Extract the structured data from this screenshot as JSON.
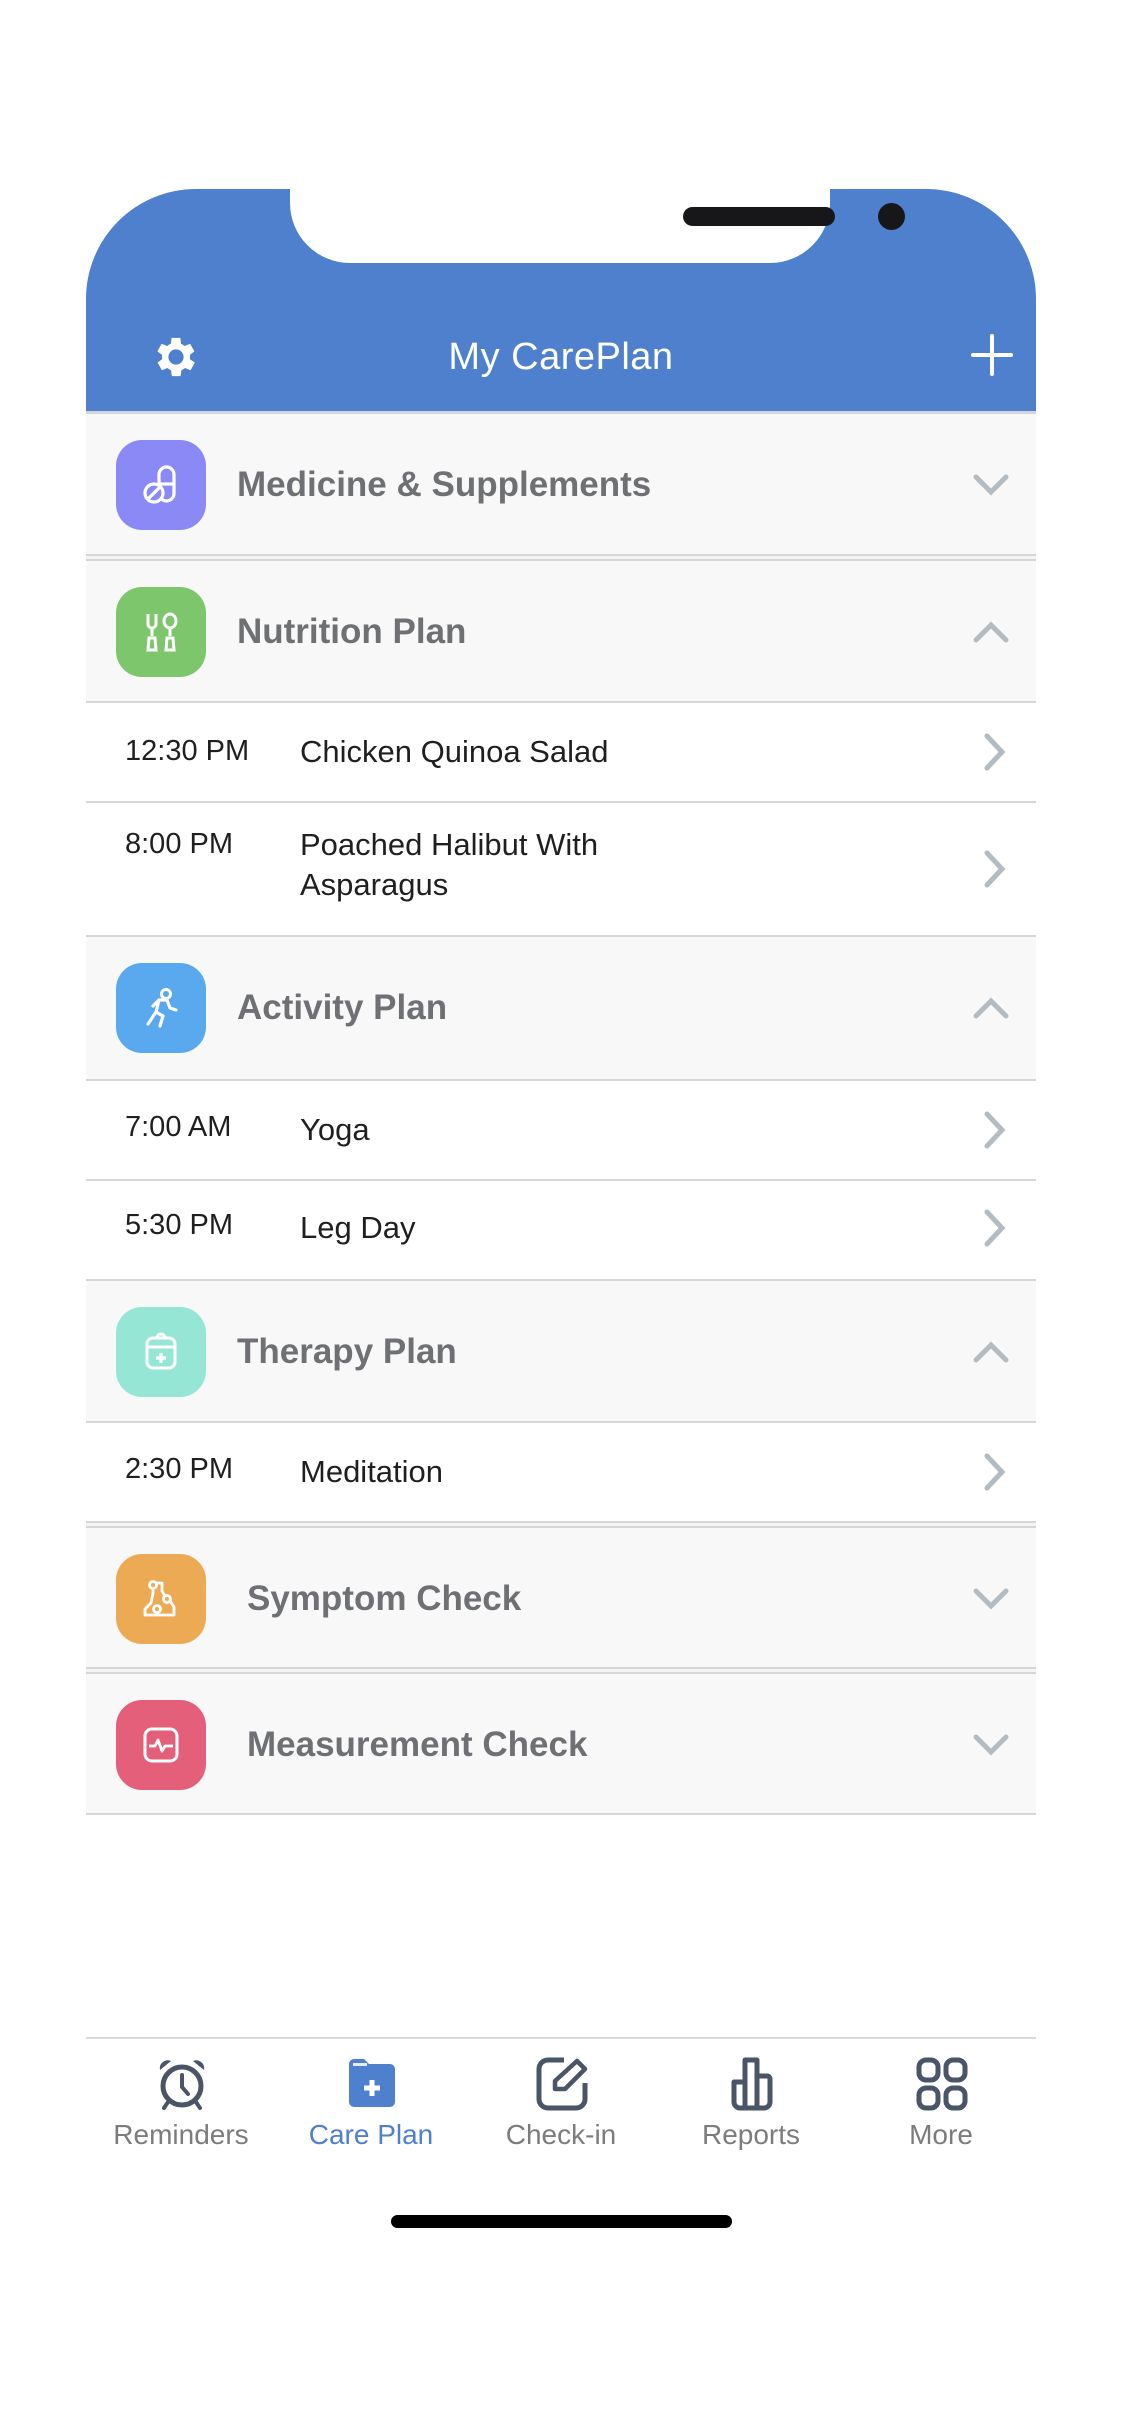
{
  "header": {
    "title": "My CarePlan",
    "left_icon": "gear-icon",
    "right_icon": "plus-icon",
    "background": "#4F80CD"
  },
  "sections": [
    {
      "id": "medicine",
      "label": "Medicine & Supplements",
      "icon": "pills-icon",
      "color": "#8B89F5",
      "expanded": false,
      "items": []
    },
    {
      "id": "nutrition",
      "label": "Nutrition Plan",
      "icon": "utensils-icon",
      "color": "#7DC66B",
      "expanded": true,
      "items": [
        {
          "time": "12:30 PM",
          "name": "Chicken Quinoa Salad"
        },
        {
          "time": "8:00 PM",
          "name": "Poached Halibut With Asparagus"
        }
      ]
    },
    {
      "id": "activity",
      "label": "Activity Plan",
      "icon": "running-icon",
      "color": "#5AA8EE",
      "expanded": true,
      "items": [
        {
          "time": "7:00 AM",
          "name": "Yoga"
        },
        {
          "time": "5:30 PM",
          "name": "Leg Day"
        }
      ]
    },
    {
      "id": "therapy",
      "label": "Therapy Plan",
      "icon": "medical-bag-icon",
      "color": "#96E6D6",
      "expanded": true,
      "items": [
        {
          "time": "2:30 PM",
          "name": "Meditation"
        }
      ]
    },
    {
      "id": "symptom",
      "label": "Symptom Check",
      "icon": "body-symptom-icon",
      "color": "#EDAA55",
      "expanded": false,
      "items": []
    },
    {
      "id": "measurement",
      "label": "Measurement Check",
      "icon": "heart-monitor-icon",
      "color": "#E45F7A",
      "expanded": false,
      "items": []
    }
  ],
  "tabbar": {
    "active": "Care Plan",
    "active_color": "#4F80CD",
    "tabs": [
      {
        "label": "Reminders",
        "icon": "alarm-clock-icon"
      },
      {
        "label": "Care Plan",
        "icon": "folder-plus-icon"
      },
      {
        "label": "Check-in",
        "icon": "edit-square-icon"
      },
      {
        "label": "Reports",
        "icon": "bar-chart-icon"
      },
      {
        "label": "More",
        "icon": "grid-icon"
      }
    ]
  }
}
